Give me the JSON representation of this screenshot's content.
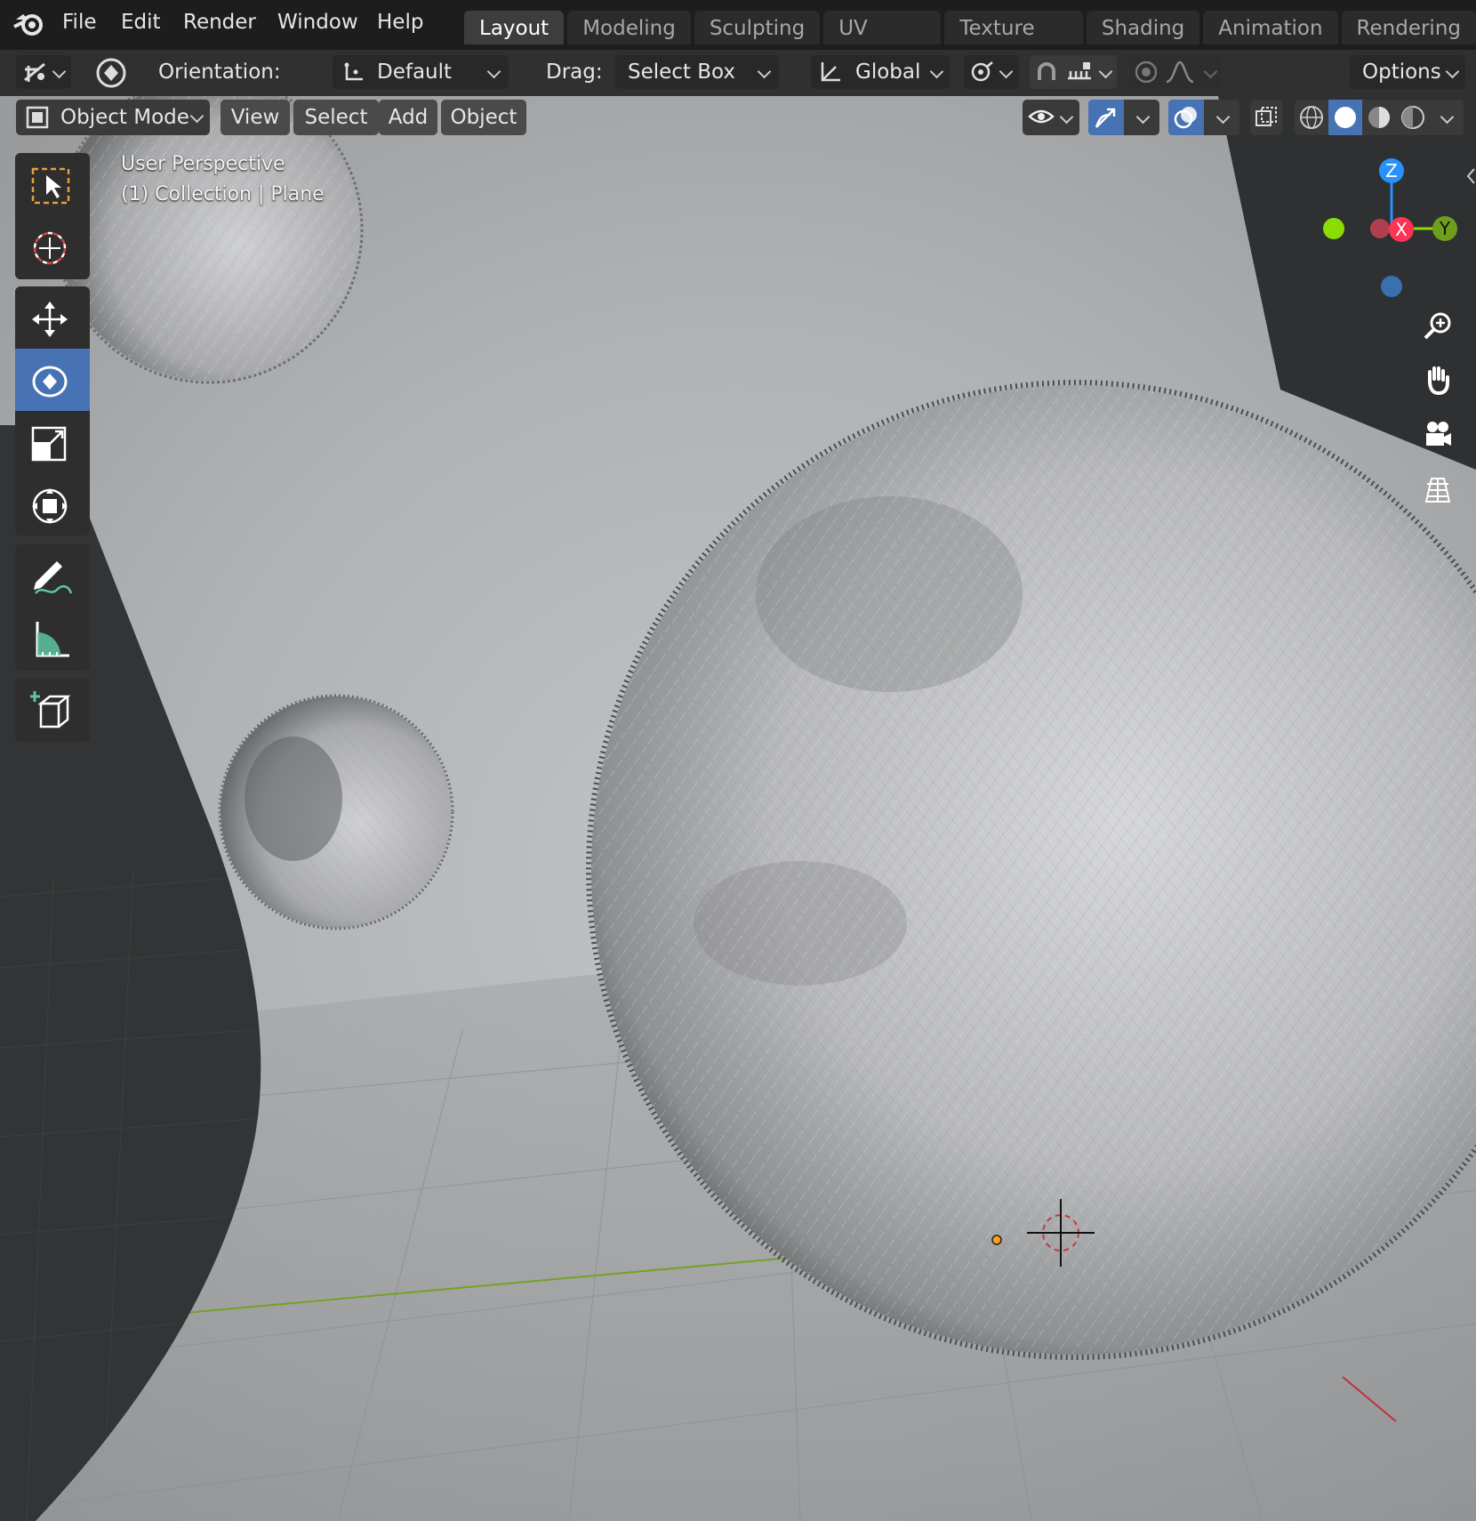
{
  "topbar": {
    "menus": [
      "File",
      "Edit",
      "Render",
      "Window",
      "Help"
    ],
    "workspaces": [
      "Layout",
      "Modeling",
      "Sculpting",
      "UV Editing",
      "Texture Paint",
      "Shading",
      "Animation",
      "Rendering"
    ],
    "active_workspace": "Layout"
  },
  "tool_header": {
    "orientation_label": "Orientation:",
    "orientation_value": "Default",
    "drag_label": "Drag:",
    "drag_value": "Select Box",
    "transform_orientation": "Global",
    "options_label": "Options"
  },
  "viewport_header": {
    "mode": "Object Mode",
    "menus": [
      "View",
      "Select",
      "Add",
      "Object"
    ]
  },
  "viewport": {
    "view_name": "User Perspective",
    "collection_info": "(1) Collection | Plane"
  },
  "gizmo": {
    "z_label": "Z",
    "x_label": "X",
    "y_label": "Y"
  },
  "colors": {
    "accent": "#4772b3",
    "axis_x": "#ff3352",
    "axis_y": "#8bdc00",
    "axis_z": "#2890ff"
  }
}
